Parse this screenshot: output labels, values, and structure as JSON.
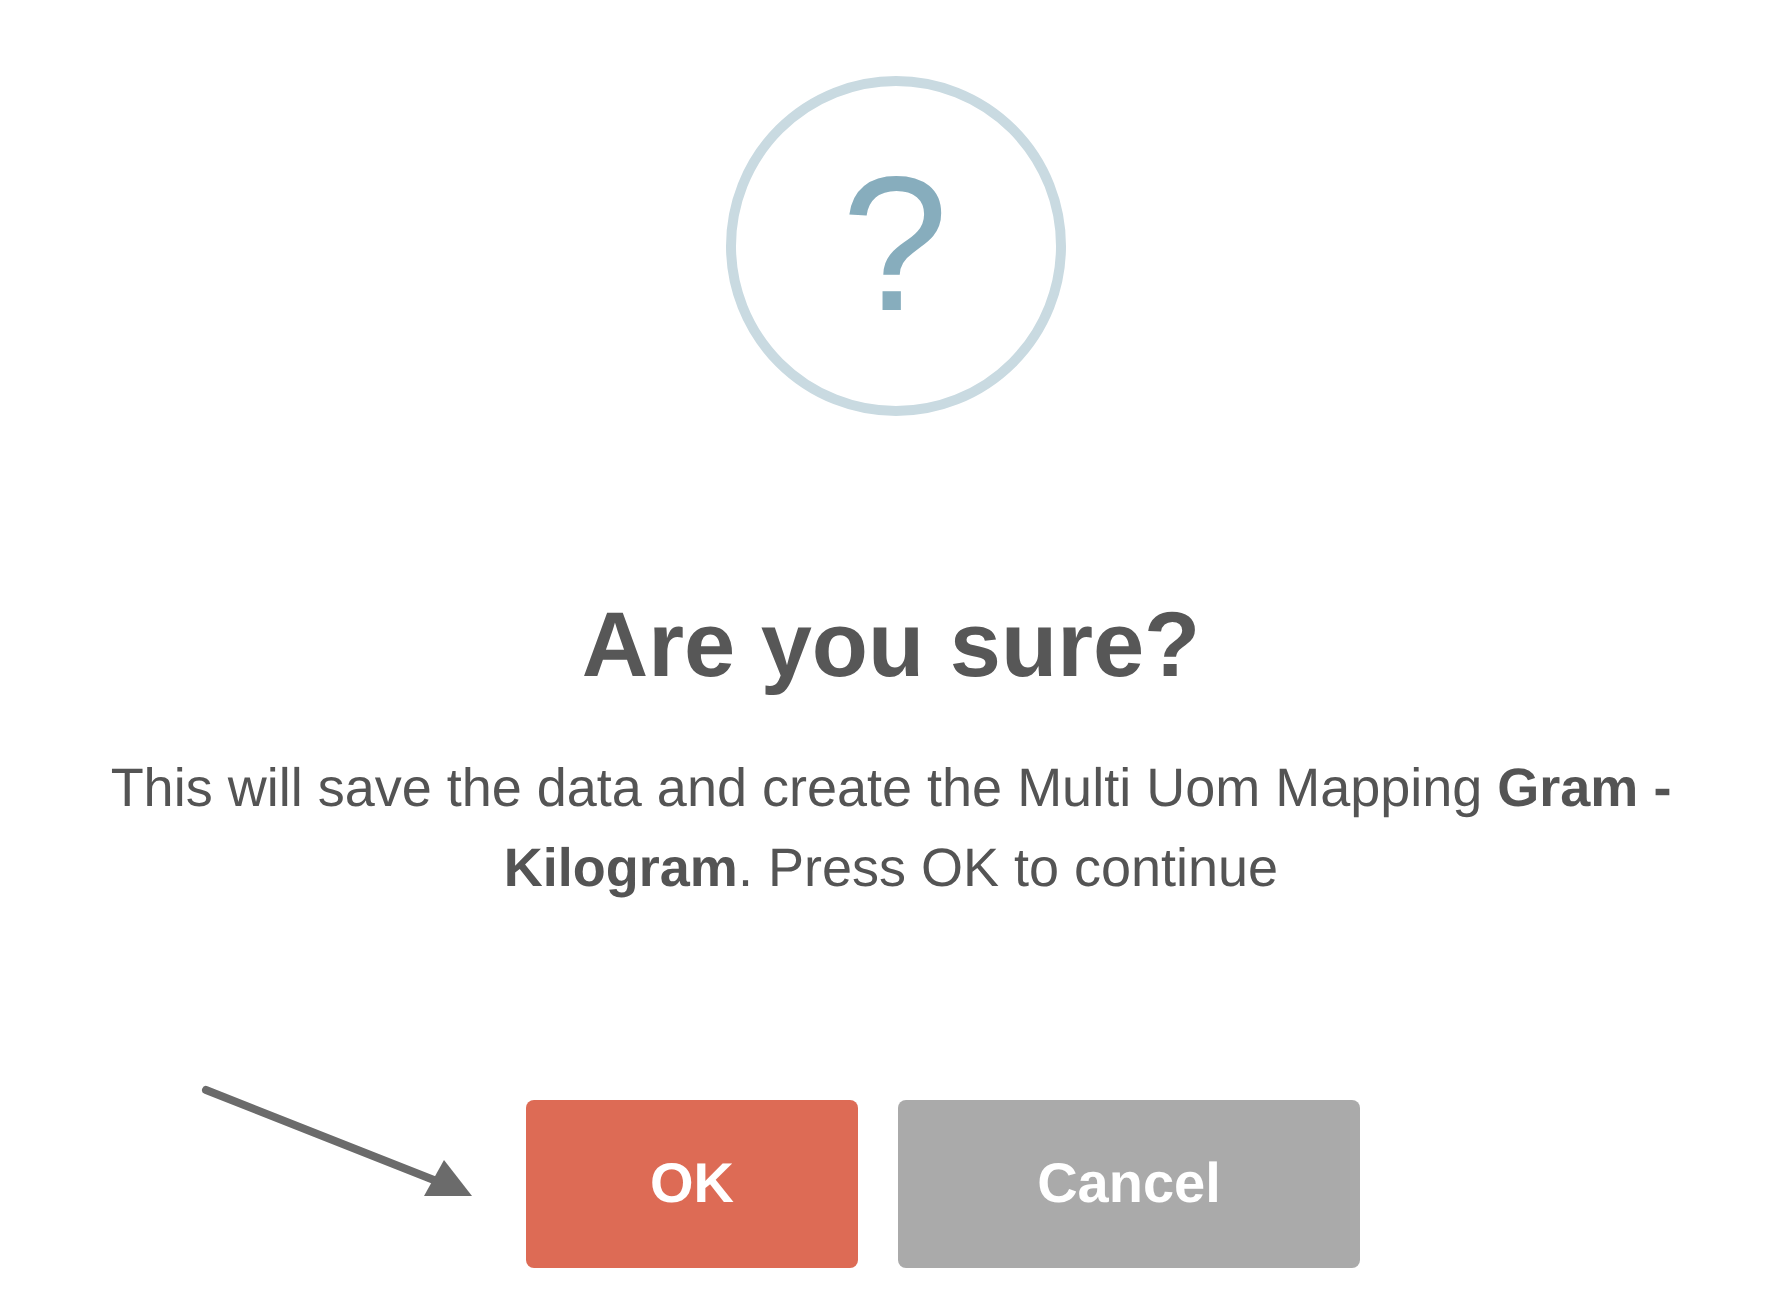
{
  "dialog": {
    "icon": "?",
    "title": "Are you sure?",
    "message": "This will save the data and create the Multi Uom Mapping **Gram - Kilogram**. Press OK to continue",
    "buttons": [
      {
        "label": "OK",
        "kind": "confirm"
      },
      {
        "label": "Cancel",
        "kind": "cancel"
      }
    ]
  }
}
